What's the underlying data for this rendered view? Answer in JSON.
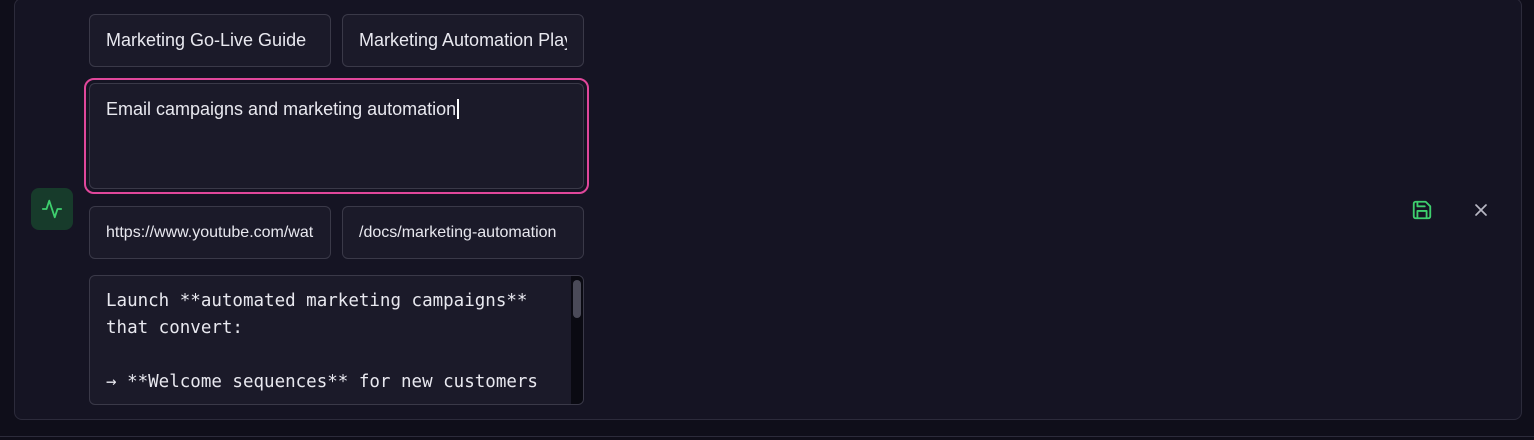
{
  "form": {
    "title_value": "Marketing Go-Live Guide",
    "subtitle_value": "Marketing Automation Playbook",
    "description_value": "Email campaigns and marketing automation",
    "video_url_value": "https://www.youtube.com/watch",
    "doc_path_value": "/docs/marketing-automation",
    "content_value": "Launch **automated marketing campaigns** that convert:\n\n→ **Welcome sequences** for new customers"
  },
  "icons": {
    "type_icon": "activity-icon",
    "save_icon": "save-icon",
    "close_icon": "close-icon"
  },
  "colors": {
    "focus_border": "#e0479b",
    "accent_green": "#3ecf6e",
    "background": "#151423"
  }
}
